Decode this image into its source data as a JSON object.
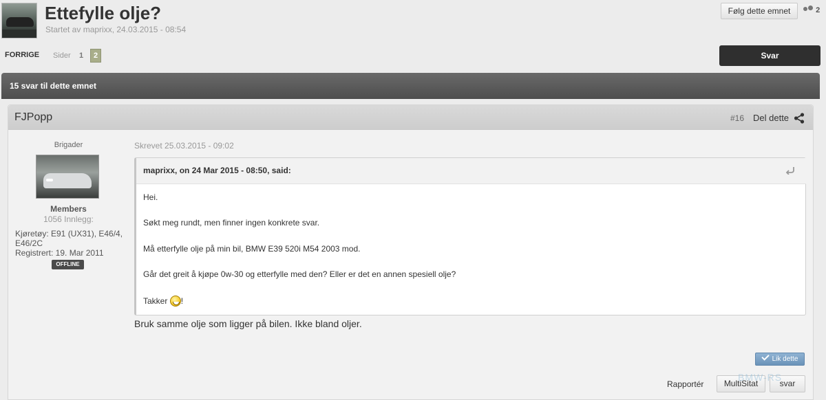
{
  "topic": {
    "title": "Ettefylle olje?",
    "started_by": "Startet av maprixx, 24.03.2015 - 08:54",
    "follow_label": "Følg dette emnet",
    "followers_count": "2"
  },
  "pagination": {
    "prev_label": "FORRIGE",
    "pages_label": "Sider",
    "pages": [
      "1",
      "2"
    ],
    "current_page": "2"
  },
  "reply_button": "Svar",
  "reply_count_label": "15 svar til dette emnet",
  "post": {
    "author": "FJPopp",
    "number": "#16",
    "share_label": "Del dette",
    "author_info": {
      "rank": "Brigader",
      "group": "Members",
      "post_count": "1056 Innlegg:",
      "car_field": "Kjøretøy: E91 (UX31), E46/4, E46/2C",
      "registered": "Registrert: 19. Mar 2011",
      "status": "OFFLINE"
    },
    "written": "Skrevet 25.03.2015 - 09:02",
    "quote": {
      "citation": "maprixx, on 24 Mar 2015 - 08:50, said:",
      "lines": [
        "Hei.",
        "Søkt meg rundt, men finner ingen konkrete svar.",
        "Må etterfylle olje på min bil, BMW E39 520i M54 2003 mod.",
        "Går det greit å kjøpe 0w-30 og etterfylle med den? Eller er det en annen spesiell olje?"
      ],
      "last_line": "Takker",
      "last_line_suffix": "!"
    },
    "text": "Bruk samme olje som ligger på bilen. Ikke bland oljer.",
    "like_label": "Lik dette",
    "report_label": "Rapportér",
    "multiquote_label": "MultiSitat",
    "quote_reply_label": "svar"
  },
  "watermark": "BMW-RS",
  "icons": {
    "followers": "users-icon",
    "share": "share-icon",
    "quote_jump": "return-arrow-icon",
    "smiley": "grin-smiley-icon",
    "like": "check-icon"
  }
}
